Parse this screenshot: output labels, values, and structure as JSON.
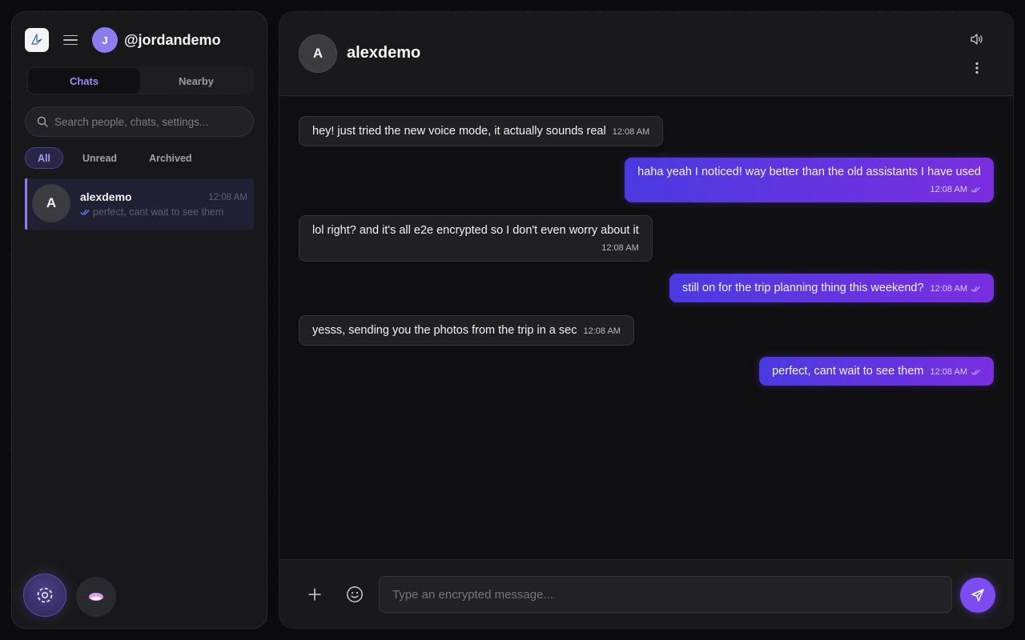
{
  "sidebar": {
    "user": {
      "avatar_initial": "J",
      "handle": "@jordandemo"
    },
    "tabs": [
      {
        "label": "Chats",
        "active": true
      },
      {
        "label": "Nearby",
        "active": false
      }
    ],
    "search": {
      "placeholder": "Search people, chats, settings..."
    },
    "filters": [
      {
        "label": "All",
        "active": true
      },
      {
        "label": "Unread"
      },
      {
        "label": "Archived"
      }
    ],
    "chats": [
      {
        "avatar_initial": "A",
        "name": "alexdemo",
        "time": "12:08 AM",
        "preview": "perfect, cant wait to see them"
      }
    ]
  },
  "conversation": {
    "contact": {
      "avatar_initial": "A",
      "name": "alexdemo"
    },
    "messages": [
      {
        "direction": "in",
        "text": "hey! just tried the new voice mode, it actually sounds real",
        "time": "12:08 AM"
      },
      {
        "direction": "out",
        "text": "haha yeah I noticed! way better than the old assistants I have used",
        "time": "12:08 AM"
      },
      {
        "direction": "in",
        "text": "lol right? and it's all e2e encrypted so I don't even worry about it",
        "time": "12:08 AM"
      },
      {
        "direction": "out",
        "text": "still on for the trip planning thing this weekend?",
        "time": "12:08 AM"
      },
      {
        "direction": "in",
        "text": "yesss, sending you the photos from the trip in a sec",
        "time": "12:08 AM"
      },
      {
        "direction": "out",
        "text": "perfect, cant wait to see them",
        "time": "12:08 AM"
      }
    ]
  },
  "composer": {
    "placeholder": "Type an encrypted message..."
  },
  "colors": {
    "accent": "#8b7cf0",
    "outgoing_bubble_start": "#4a3ae0",
    "outgoing_bubble_end": "#7a2ee0",
    "send_button": "#7c4cf0"
  }
}
